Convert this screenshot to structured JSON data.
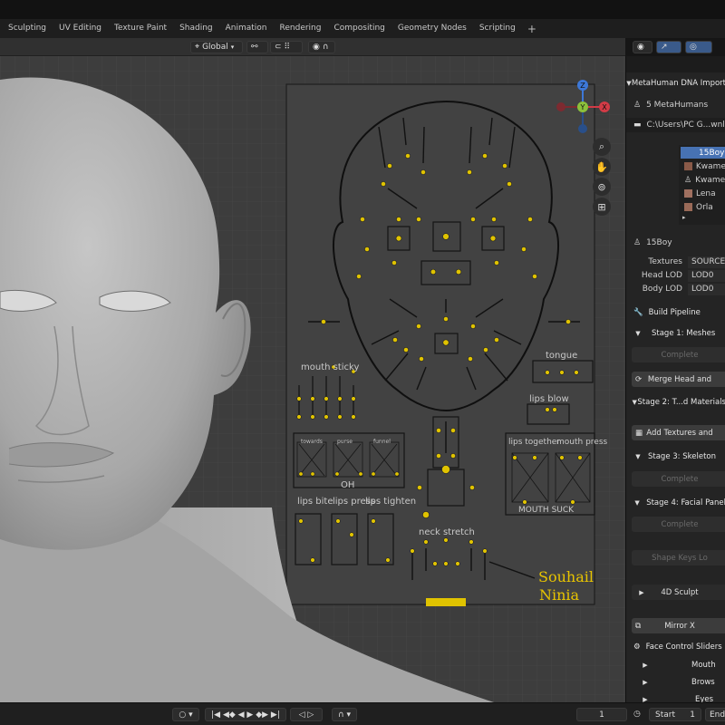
{
  "workspace_tabs": [
    "Sculpting",
    "UV Editing",
    "Texture Paint",
    "Shading",
    "Animation",
    "Rendering",
    "Compositing",
    "Geometry Nodes",
    "Scripting",
    "+"
  ],
  "viewport_header": {
    "orientation": "Global"
  },
  "gizmo": {
    "z": "Z",
    "y": "Y",
    "x": "X"
  },
  "face_rig": {
    "labels": {
      "mouth_sticky": "mouth sticky",
      "tongue": "tongue",
      "lips_blow": "lips blow",
      "oh_sub": [
        "towards",
        "purse",
        "funnel"
      ],
      "oh": "OH",
      "lips_together": "lips together",
      "mouth_press": "mouth press",
      "mouth_suck": "MOUTH SUCK",
      "lips_bite": "lips bite",
      "lips_press": "lips press",
      "lips_tighten": "lips tighten",
      "neck_stretch": "neck stretch"
    },
    "signature": [
      "Souhail",
      "Ninia"
    ]
  },
  "panel": {
    "title": "MetaHuman DNA Import",
    "count": "5 MetaHumans",
    "path": "C:\\Users\\PC G...wnload",
    "list": [
      {
        "name": "15Boy",
        "selected": true
      },
      {
        "name": "Kwame",
        "selected": false
      },
      {
        "name": "Kwame",
        "selected": false
      },
      {
        "name": "Lena",
        "selected": false
      },
      {
        "name": "Orla",
        "selected": false
      }
    ],
    "current": "15Boy",
    "props": [
      {
        "label": "Textures",
        "value": "SOURCE"
      },
      {
        "label": "Head LOD",
        "value": "LOD0"
      },
      {
        "label": "Body LOD",
        "value": "LOD0"
      }
    ],
    "build_pipeline": "Build Pipeline",
    "stage1": "Stage 1: Meshes",
    "complete": "Complete",
    "merge": "Merge Head and",
    "stage2": "Stage 2: T...d Materials",
    "add_textures": "Add Textures and",
    "stage3": "Stage 3: Skeleton",
    "stage4": "Stage 4: Facial Panel",
    "shape_keys": "Shape Keys Lo",
    "sculpt": "4D Sculpt",
    "mirror": "Mirror X",
    "face_sliders": "Face Control Sliders",
    "slider_groups": [
      "Mouth",
      "Brows",
      "Eyes"
    ]
  },
  "statusbar": {
    "frame": "1",
    "start_label": "Start",
    "start_value": "1",
    "end_label": "End"
  }
}
